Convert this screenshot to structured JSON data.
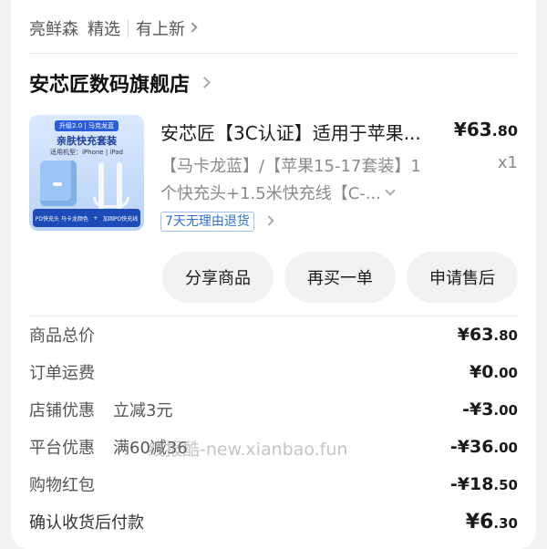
{
  "header": {
    "tag1": "亮鲜森",
    "tag2": "精选",
    "tag3": "有上新"
  },
  "store": {
    "name": "安芯匠数码旗舰店"
  },
  "product": {
    "title": "安芯匠【3C认证】适用于苹果...",
    "price_int": "¥63",
    "price_dec": ".80",
    "spec_line1": "【马卡龙蓝】/【苹果15-17套装】1",
    "spec_line2": "个快充头+1.5米快充线【C-...",
    "qty": "x1",
    "return_policy": "7天无理由退货",
    "image": {
      "ribbon": "升级2.0 | 马克龙蓝",
      "title": "亲肤快充套装",
      "subtitle": "适用机型：iPhone | iPad",
      "left_caption": "PD快充头 马卡龙颜色",
      "right_caption": "加固PD快充线"
    }
  },
  "actions": {
    "share": "分享商品",
    "rebuy": "再买一单",
    "after_sale": "申请售后"
  },
  "summary": {
    "total_label": "商品总价",
    "total_int": "¥63",
    "total_dec": ".80",
    "shipping_label": "订单运费",
    "shipping_int": "¥0",
    "shipping_dec": ".00",
    "store_discount_label": "店铺优惠",
    "store_discount_note": "立减3元",
    "store_discount_int": "-¥3",
    "store_discount_dec": ".00",
    "platform_discount_label": "平台优惠",
    "platform_discount_note": "满60减36",
    "platform_discount_int": "-¥36",
    "platform_discount_dec": ".00",
    "red_packet_label": "购物红包",
    "red_packet_int": "-¥18",
    "red_packet_dec": ".50",
    "pay_label": "确认收货后付款",
    "pay_int": "¥6",
    "pay_dec": ".30"
  },
  "watermark": "线报酷-new.xianbao.fun"
}
